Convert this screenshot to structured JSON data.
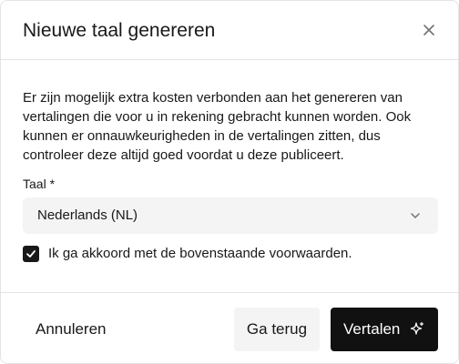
{
  "dialog": {
    "title": "Nieuwe taal genereren",
    "close_icon": "close-icon"
  },
  "body": {
    "description": "Er zijn mogelijk extra kosten verbonden aan het genereren van vertalingen die voor u in rekening gebracht kunnen worden. Ook kunnen er onnauwkeurigheden in de vertalingen zitten, dus controleer deze altijd goed voordat u deze publiceert.",
    "language_label": "Taal *",
    "language_value": "Nederlands (NL)",
    "agree_checked": true,
    "agree_label": "Ik ga akkoord met de bovenstaande voorwaarden."
  },
  "footer": {
    "cancel_label": "Annuleren",
    "back_label": "Ga terug",
    "translate_label": "Vertalen",
    "translate_icon": "sparkle-icon"
  },
  "colors": {
    "primary": "#111111",
    "secondary_bg": "#f4f4f5",
    "border": "#e4e4e7",
    "text": "#18181b"
  }
}
